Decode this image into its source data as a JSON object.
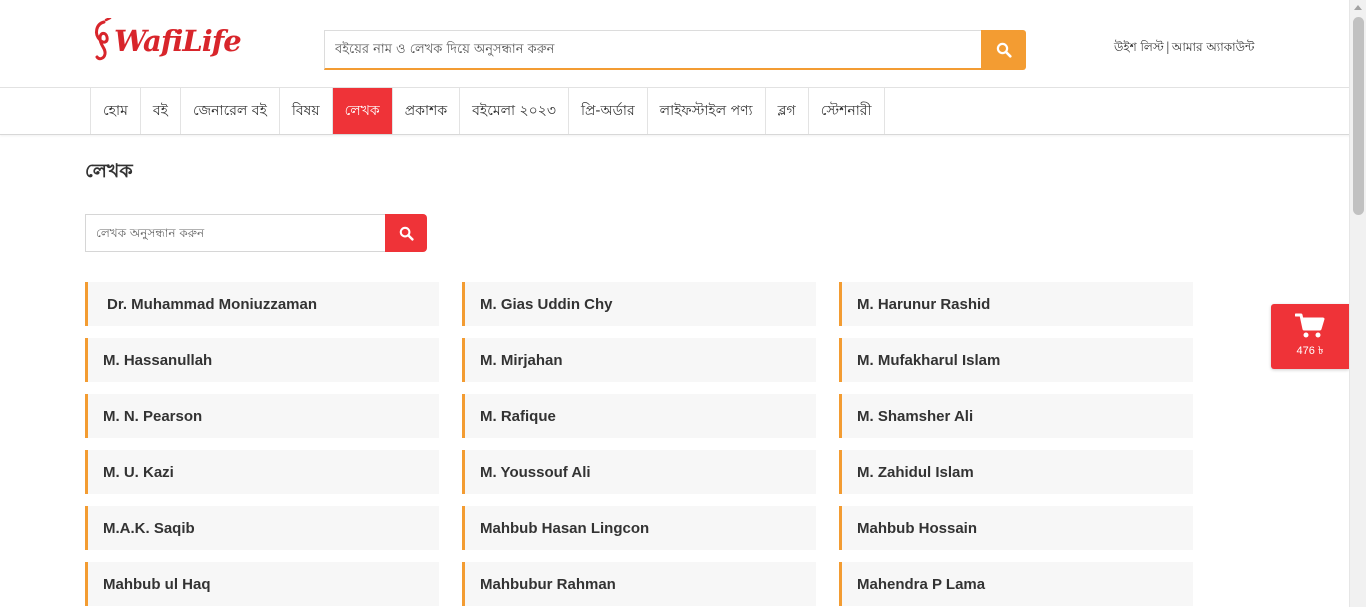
{
  "header": {
    "brand": "WafiLife",
    "search_placeholder": "বইয়ের নাম ও লেখক দিয়ে অনুসন্ধান করুন",
    "wishlist": "উইশ লিস্ট",
    "separator": "|",
    "account": "আমার অ্যাকাউন্ট"
  },
  "nav": {
    "items": [
      {
        "label": "হোম"
      },
      {
        "label": "বই"
      },
      {
        "label": "জেনারেল বই"
      },
      {
        "label": "বিষয়"
      },
      {
        "label": "লেখক"
      },
      {
        "label": "প্রকাশক"
      },
      {
        "label": "বইমেলা ২০২৩"
      },
      {
        "label": "প্রি-অর্ডার"
      },
      {
        "label": "লাইফস্টাইল পণ্য"
      },
      {
        "label": "ব্লগ"
      },
      {
        "label": "স্টেশনারী"
      }
    ],
    "active_index": 4
  },
  "page": {
    "title": "লেখক",
    "author_search_placeholder": "লেখক অনুসন্ধান করুন"
  },
  "authors": [
    "Dr. Muhammad Moniuzzaman",
    "M. Gias Uddin Chy",
    "M. Harunur Rashid",
    "M. Hassanullah",
    "M. Mirjahan",
    "M. Mufakharul Islam",
    "M. N. Pearson",
    "M. Rafique",
    "M. Shamsher Ali",
    "M. U. Kazi",
    "M. Youssouf Ali",
    "M. Zahidul Islam",
    "M.A.K. Saqib",
    "Mahbub Hasan Lingcon",
    "Mahbub Hossain",
    "Mahbub ul Haq",
    "Mahbubur Rahman",
    "Mahendra P Lama"
  ],
  "cart": {
    "total": "476 ৳"
  },
  "colors": {
    "brand_red": "#ef3338",
    "accent_orange": "#f39c32",
    "card_bg": "#f7f7f7"
  },
  "icons": {
    "search": "search-icon",
    "cart": "cart-icon"
  }
}
